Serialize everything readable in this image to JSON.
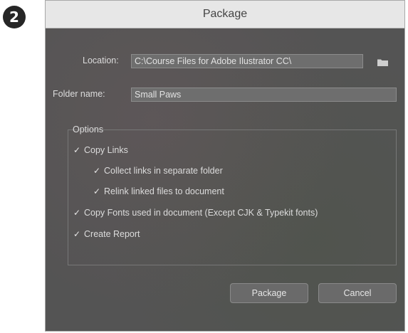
{
  "step": "2",
  "window": {
    "title": "Package"
  },
  "location": {
    "label": "Location:",
    "value": "C:\\Course Files for Adobe Ilustrator CC\\"
  },
  "folder": {
    "label": "Folder name:",
    "value": "Small Paws"
  },
  "options": {
    "heading": "Options",
    "items": [
      {
        "label": "Copy Links",
        "checked": true
      },
      {
        "label": "Collect links in separate folder",
        "checked": true
      },
      {
        "label": "Relink linked files to document",
        "checked": true
      },
      {
        "label": "Copy Fonts used in document (Except CJK & Typekit fonts)",
        "checked": true
      },
      {
        "label": "Create Report",
        "checked": true
      }
    ]
  },
  "buttons": {
    "package": "Package",
    "cancel": "Cancel"
  },
  "icons": {
    "folder": "folder-icon",
    "check": "checkmark-icon"
  }
}
